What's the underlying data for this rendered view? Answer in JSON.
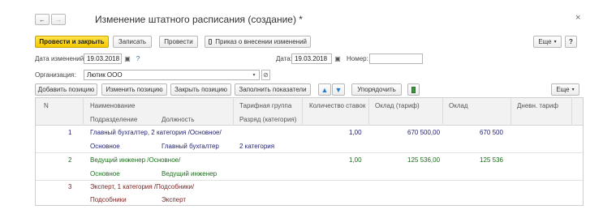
{
  "nav": {
    "back": "←",
    "forward": "→"
  },
  "window": {
    "title": "Изменение штатного расписания (создание) *",
    "close": "×"
  },
  "toolbar": {
    "post_close": "Провести и закрыть",
    "save": "Записать",
    "post": "Провести",
    "print_order": "Приказ о внесении изменений",
    "more": "Еще",
    "help": "?"
  },
  "form": {
    "change_date_label": "Дата изменений:",
    "change_date": "19.03.2018",
    "date_label": "Дата:",
    "date": "19.03.2018",
    "number_label": "Номер:",
    "number": "",
    "org_label": "Организация:",
    "org": "Лютик ООО"
  },
  "table_toolbar": {
    "add": "Добавить позицию",
    "edit": "Изменить позицию",
    "close_pos": "Закрыть позицию",
    "fill": "Заполнить показатели",
    "sort": "Упорядочить",
    "more": "Еще"
  },
  "table": {
    "headers": {
      "n": "N",
      "name": "Наименование",
      "division": "Подразделение",
      "position": "Должность",
      "tariff_group": "Тарифная группа",
      "category": "Разряд (категория)",
      "count": "Количество ставок",
      "salary_tariff": "Оклад (тариф)",
      "salary": "Оклад",
      "daily": "Дневн. тариф"
    },
    "rows": [
      {
        "n": "1",
        "name": "Главный бухгалтер, 2 категория /Основное/",
        "division": "Основное",
        "position": "Главный бухгалтер",
        "category": "2 категория",
        "count": "1,00",
        "salary_tariff": "670 500,00",
        "salary": "670 500",
        "color": "#1f1f6e"
      },
      {
        "n": "2",
        "name": "Ведущий инженер /Основное/",
        "division": "Основное",
        "position": "Ведущий инженер",
        "category": "",
        "count": "1,00",
        "salary_tariff": "125 536,00",
        "salary": "125 536",
        "color": "#1e6b1e"
      },
      {
        "n": "3",
        "name": "Эксперт, 1 категория /Подсобники/",
        "division": "Подсобники",
        "position": "Эксперт",
        "category": "",
        "count": "",
        "salary_tariff": "",
        "salary": "",
        "color": "#7a1f1f"
      }
    ]
  },
  "colors": {
    "accent": "#f5c800",
    "link": "#2a6fb0"
  }
}
